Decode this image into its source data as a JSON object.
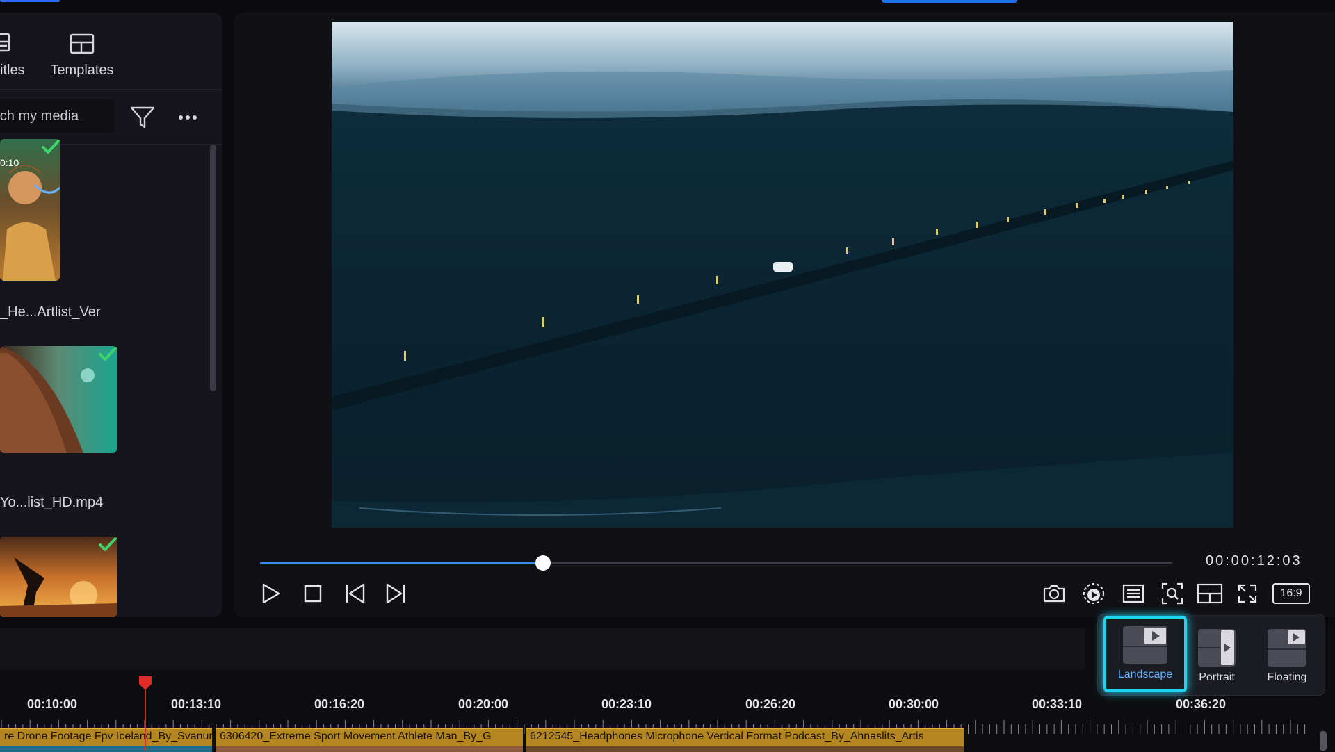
{
  "media_panel": {
    "tabs": [
      {
        "label": "itles",
        "icon": "titles-icon"
      },
      {
        "label": "Templates",
        "icon": "templates-icon"
      }
    ],
    "search": {
      "placeholder": "arch my media"
    },
    "items": [
      {
        "duration": "0:10",
        "name": "_He...Artlist_Ver",
        "checked": true
      },
      {
        "name": "Yo...list_HD.mp4",
        "checked": true
      },
      {
        "name": "",
        "checked": true
      }
    ]
  },
  "preview": {
    "timecode": "00:00:12:03",
    "progress": 0.31,
    "aspect_ratio_label": "16:9",
    "controls": [
      "play-icon",
      "stop-icon",
      "previous-frame-icon",
      "next-frame-icon"
    ],
    "tools": [
      "snapshot-icon",
      "render-preview-icon",
      "subtitles-icon",
      "zoom-icon",
      "layout-icon",
      "fullscreen-icon"
    ]
  },
  "layout_menu": {
    "options": [
      {
        "label": "Landscape",
        "selected": true
      },
      {
        "label": "Portrait",
        "selected": false
      },
      {
        "label": "Floating",
        "selected": false
      }
    ]
  },
  "timeline": {
    "ruler": [
      "00:10:00",
      "00:13:10",
      "00:16:20",
      "00:20:00",
      "00:23:10",
      "00:26:20",
      "00:30:00",
      "00:33:10",
      "00:36:20"
    ],
    "clips": [
      {
        "title": "re Drone Footage Fpv Iceland_By_Svanur"
      },
      {
        "title": "6306420_Extreme Sport Movement Athlete Man_By_G"
      },
      {
        "title": "6212545_Headphones Microphone Vertical Format Podcast_By_Ahnaslits_Artis"
      }
    ]
  },
  "colors": {
    "accent": "#3f86f4",
    "selection_glow": "#22d3ee",
    "clip": "#b4861f",
    "playhead": "#e02a2a",
    "check": "#3ed36b"
  }
}
